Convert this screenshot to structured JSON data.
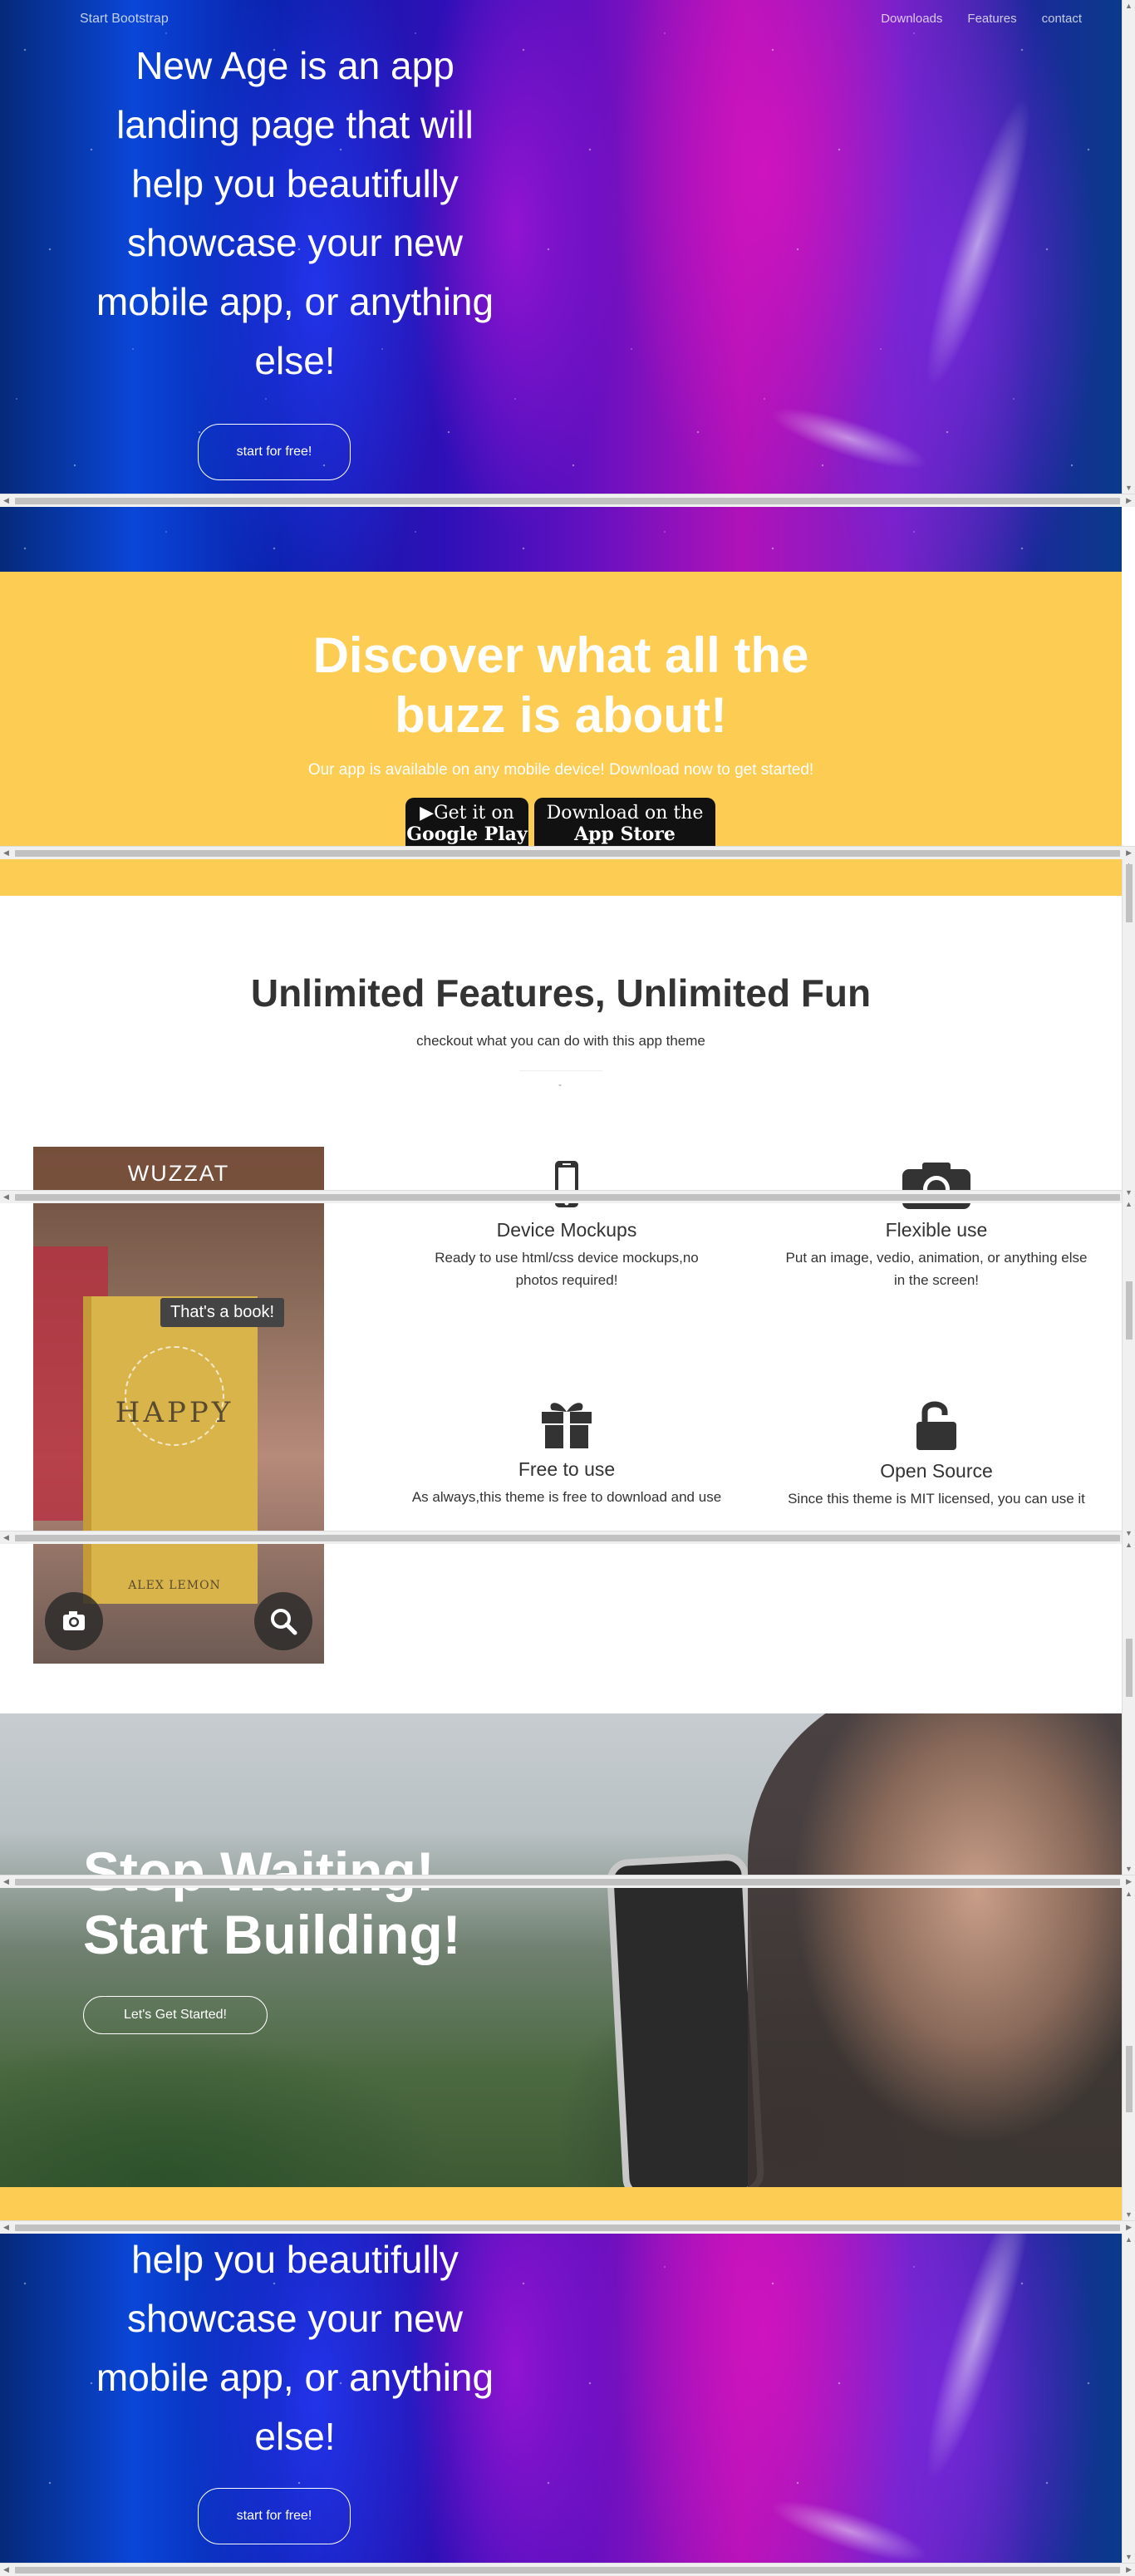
{
  "nav": {
    "brand": "Start Bootstrap",
    "links": [
      "Downloads",
      "Features",
      "contact"
    ]
  },
  "hero": {
    "heading_lines": [
      "New Age is an app",
      "landing page that will",
      "help you beautifully",
      "showcase your new",
      "mobile app, or anything",
      "else!"
    ],
    "cta": "start for free!"
  },
  "download": {
    "title_lines": [
      "Discover what all the",
      "buzz is about!"
    ],
    "subtitle": "Our app is available on any mobile device! Download now to get started!",
    "google_play": [
      "▶Get it on",
      "Google Play"
    ],
    "app_store": [
      "Download on the",
      "App Store"
    ]
  },
  "features": {
    "title": "Unlimited Features, Unlimited Fun",
    "subtitle": "checkout what you can do with this app theme",
    "divider_mark": "-",
    "app_name": "WUZZAT",
    "bubble": "That's a book!",
    "book_title": "HAPPY",
    "book_author": "ALEX LEMON",
    "items": [
      {
        "title": "Device Mockups",
        "desc": [
          "Ready to use html/css device mockups,no",
          "photos required!"
        ]
      },
      {
        "title": "Flexible use",
        "desc": [
          "Put an image, vedio, animation, or anything else",
          "in the screen!"
        ]
      },
      {
        "title": "Free to use",
        "desc": [
          "As always,this theme is free to download and use"
        ]
      },
      {
        "title": "Open Source",
        "desc": [
          "Since this theme is MIT licensed, you can use it"
        ]
      }
    ]
  },
  "cta": {
    "title_lines": [
      "Stop Waiting!",
      "Start Building!"
    ],
    "button": "Let's Get Started!"
  },
  "hero_repeat": {
    "heading_lines": [
      "help you beautifully",
      "showcase your new",
      "mobile app, or anything",
      "else!"
    ],
    "cta": "start for free!"
  }
}
